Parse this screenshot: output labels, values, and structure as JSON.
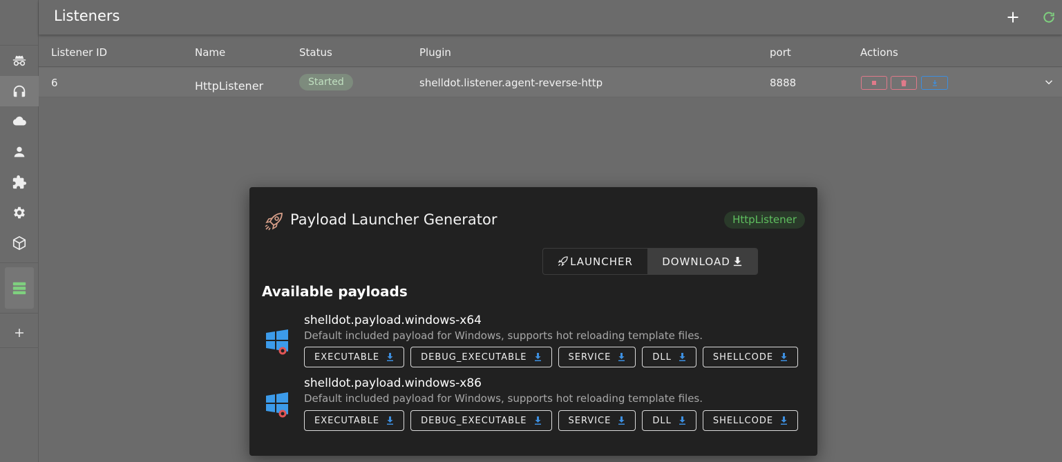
{
  "header": {
    "title": "Listeners",
    "add_icon": "plus-icon",
    "refresh_icon": "refresh-icon"
  },
  "sidebar": {
    "items": [
      {
        "icon": "incognito-icon",
        "active": false
      },
      {
        "icon": "headphones-icon",
        "active": true
      },
      {
        "icon": "cloud-icon",
        "active": false
      },
      {
        "icon": "user-icon",
        "active": false
      },
      {
        "icon": "puzzle-icon",
        "active": false
      },
      {
        "icon": "gear-icon",
        "active": false
      },
      {
        "icon": "package-icon",
        "active": false
      }
    ],
    "server_icon": "server-icon",
    "add_icon": "plus-icon"
  },
  "table": {
    "columns": [
      "Listener ID",
      "Name",
      "Status",
      "Plugin",
      "port",
      "Actions"
    ],
    "rows": [
      {
        "id": "6",
        "name": "HttpListener",
        "status": "Started",
        "plugin": "shelldot.listener.agent-reverse-http",
        "port": "8888"
      }
    ]
  },
  "modal": {
    "title": "Payload Launcher Generator",
    "listener_chip": "HttpListener",
    "toggle": {
      "launcher": "LAUNCHER",
      "download": "DOWNLOAD"
    },
    "section_title": "Available payloads",
    "payloads": [
      {
        "name": "shelldot.payload.windows-x64",
        "description": "Default included payload for Windows, supports hot reloading template files.",
        "buttons": [
          "EXECUTABLE",
          "DEBUG_EXECUTABLE",
          "SERVICE",
          "DLL",
          "SHELLCODE"
        ]
      },
      {
        "name": "shelldot.payload.windows-x86",
        "description": "Default included payload for Windows, supports hot reloading template files.",
        "buttons": [
          "EXECUTABLE",
          "DEBUG_EXECUTABLE",
          "SERVICE",
          "DLL",
          "SHELLCODE"
        ]
      }
    ]
  },
  "colors": {
    "accent_green": "#7fd07f",
    "chip_green": "#5fbf5f",
    "download_blue": "#3d8fe0",
    "stop_red": "#e07a8a"
  }
}
